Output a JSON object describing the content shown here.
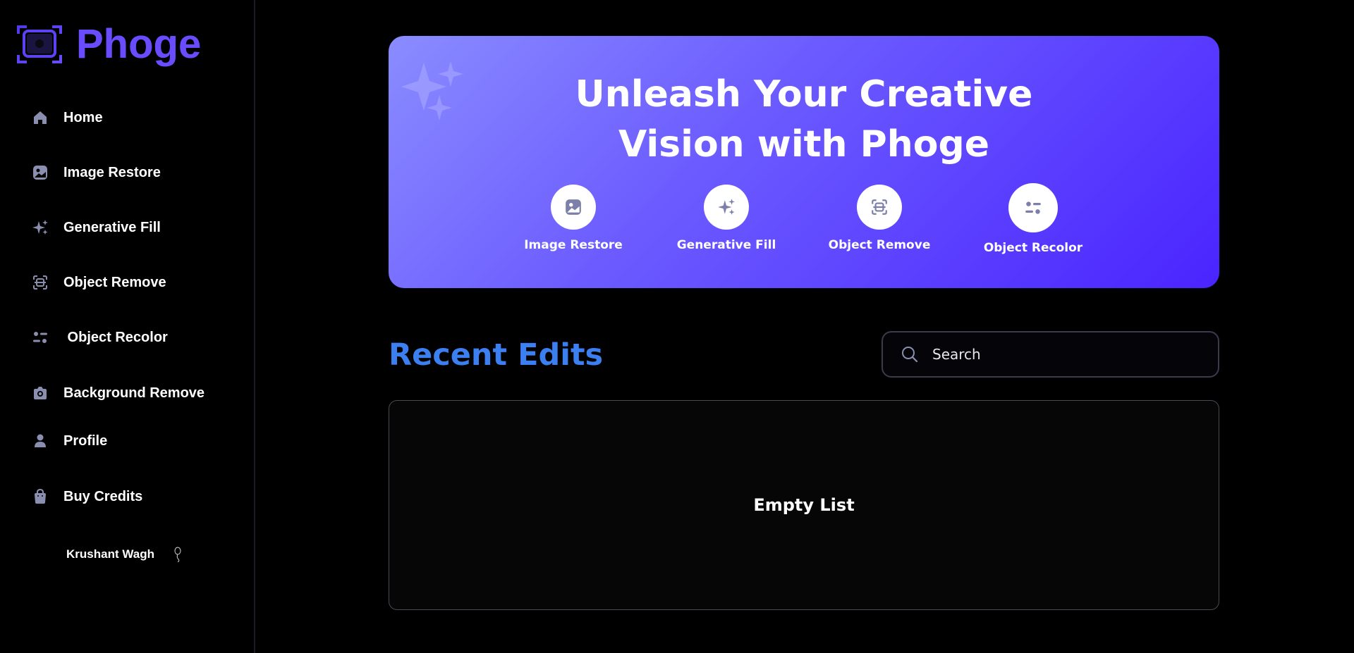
{
  "app": {
    "name": "Phoge",
    "brand_color": "#6a4cff"
  },
  "sidebar": {
    "items": [
      {
        "label": "Home",
        "icon": "home-icon"
      },
      {
        "label": "Image Restore",
        "icon": "image-icon"
      },
      {
        "label": "Generative Fill",
        "icon": "sparkles-icon"
      },
      {
        "label": "Object Remove",
        "icon": "scan-icon"
      },
      {
        "label": " Object Recolor",
        "icon": "filter-icon"
      },
      {
        "label": "Background Remove",
        "icon": "camera-icon"
      },
      {
        "label": "Profile",
        "icon": "user-icon"
      },
      {
        "label": "Buy Credits",
        "icon": "bag-icon"
      }
    ],
    "user": {
      "name": "Krushant Wagh",
      "icon": "balloon-icon"
    },
    "icon_color": "#8a8fb0"
  },
  "hero": {
    "title_line1": "Unleash Your Creative",
    "title_line2": "Vision with Phoge",
    "tools": [
      {
        "label": "Image Restore",
        "icon": "image-icon"
      },
      {
        "label": "Generative Fill",
        "icon": "sparkles-icon"
      },
      {
        "label": "Object Remove",
        "icon": "scan-icon"
      },
      {
        "label": "Object Recolor",
        "icon": "filter-icon"
      }
    ]
  },
  "recent": {
    "title": "Recent Edits",
    "title_color": "#3b7ff0",
    "search": {
      "placeholder": "Search",
      "value": ""
    },
    "empty_message": "Empty List"
  }
}
